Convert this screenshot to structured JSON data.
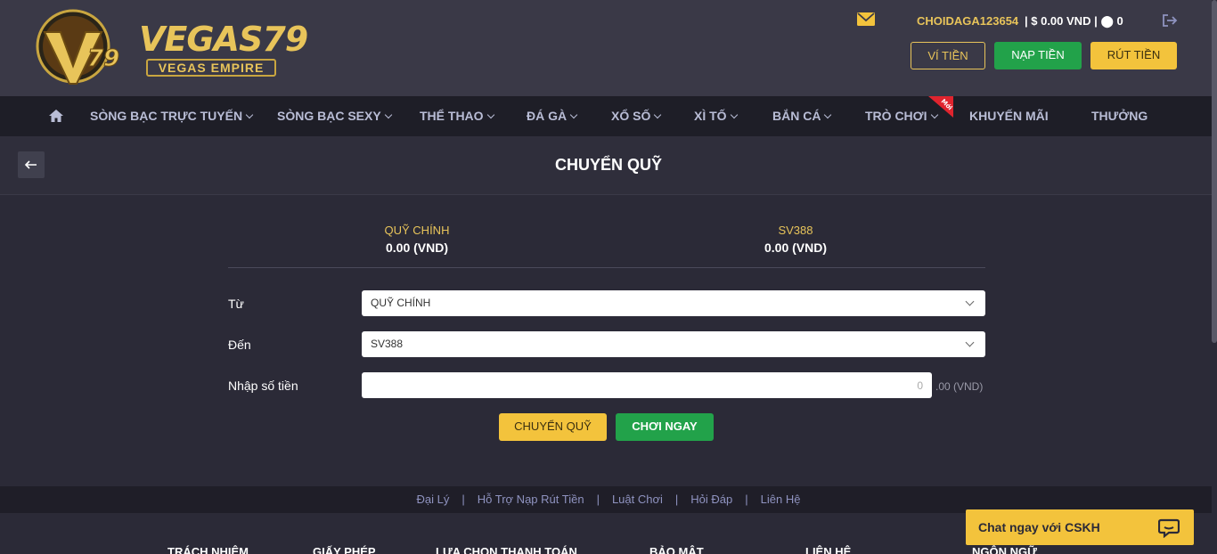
{
  "header": {
    "logo_text": "VEGAS79",
    "logo_sub": "VEGAS EMPIRE",
    "username": "CHOIDAGA123654",
    "balance": "| $ 0.00 VND | ⬤ 0",
    "btn_vitien": "VÍ TIỀN",
    "btn_nap": "NẠP TIỀN",
    "btn_rut": "RÚT TIỀN"
  },
  "nav": {
    "items": [
      {
        "label": "SÒNG BẠC TRỰC TUYẾN"
      },
      {
        "label": "SÒNG BẠC SEXY"
      },
      {
        "label": "THỂ THAO"
      },
      {
        "label": "ĐÁ GÀ"
      },
      {
        "label": "XỔ SỐ"
      },
      {
        "label": "XÌ TỐ"
      },
      {
        "label": "BẮN CÁ"
      },
      {
        "label": "TRÒ CHƠI"
      },
      {
        "label": "KHUYẾN MÃI"
      },
      {
        "label": "THƯỞNG"
      }
    ],
    "new_badge": "Mới"
  },
  "page": {
    "title": "CHUYỂN QUỸ"
  },
  "balances": {
    "main_label": "QUỸ CHÍNH",
    "main_value": "0.00 (VND)",
    "sv_label": "SV388",
    "sv_value": "0.00 (VND)"
  },
  "form": {
    "from_label": "Từ",
    "from_value": "QUỸ CHÍNH",
    "to_label": "Đến",
    "to_value": "SV388",
    "amount_label": "Nhập số tiền",
    "amount_placeholder": "0",
    "amount_unit": ".00 (VND)",
    "btn_transfer": "CHUYỂN QUỸ",
    "btn_play": "CHƠI NGAY"
  },
  "footer": {
    "links": [
      "Đại Lý",
      "Hỗ Trợ Nạp Rút Tiền",
      "Luật Chơi",
      "Hỏi Đáp",
      "Liên Hệ"
    ],
    "heads": [
      "TRÁCH NHIỆM",
      "GIẤY PHÉP",
      "LỰA CHỌN THANH TOÁN",
      "BẢO MẬT",
      "LIÊN HỆ",
      "NGÔN NGỮ"
    ]
  },
  "chat": {
    "label": "Chat ngay với CSKH"
  },
  "colors": {
    "accent": "#f3c33c",
    "green": "#22a24a",
    "nav_bg": "#1e1e27",
    "body_bg": "#2b2a37"
  },
  "icons": [
    "home-icon",
    "mail-icon",
    "logout-icon",
    "back-arrow-icon",
    "chevron-down-icon",
    "chat-icon"
  ]
}
